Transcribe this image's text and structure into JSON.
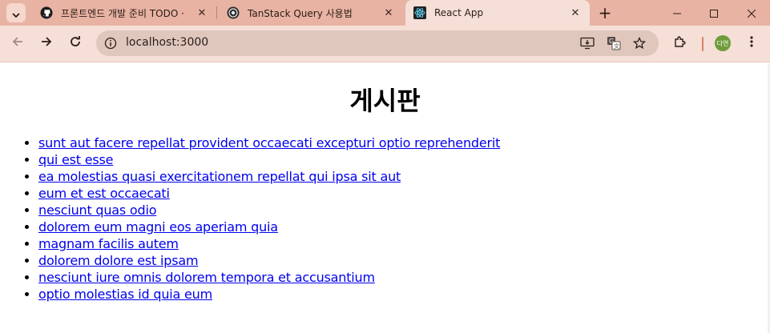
{
  "browser": {
    "tabs": [
      {
        "title": "프론트엔드 개발 준비 TODO ·",
        "icon": "github-icon",
        "active": false
      },
      {
        "title": "TanStack Query 사용법",
        "icon": "tanstack-icon",
        "active": false
      },
      {
        "title": "React App",
        "icon": "react-icon",
        "active": true
      }
    ],
    "url": "localhost:3000",
    "profile_initials": "다연"
  },
  "page": {
    "heading": "게시판",
    "posts": [
      "sunt aut facere repellat provident occaecati excepturi optio reprehenderit",
      "qui est esse",
      "ea molestias quasi exercitationem repellat qui ipsa sit aut",
      "eum et est occaecati",
      "nesciunt quas odio",
      "dolorem eum magni eos aperiam quia",
      "magnam facilis autem",
      "dolorem dolore est ipsam",
      "nesciunt iure omnis dolorem tempora et accusantium",
      "optio molestias id quia eum"
    ]
  },
  "colors": {
    "tabbar_bg": "#e8b3a3",
    "toolbar_bg": "#f5dfd7",
    "link": "#0000ee"
  }
}
